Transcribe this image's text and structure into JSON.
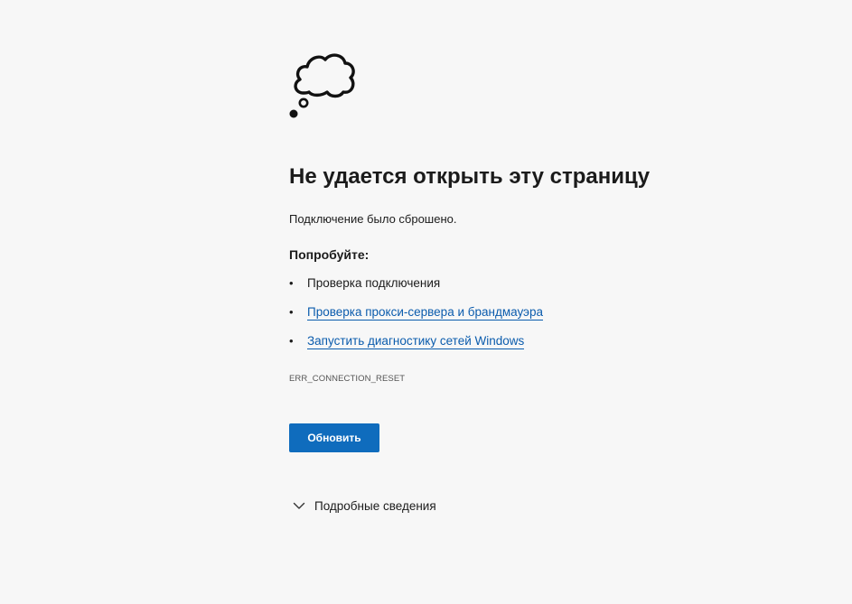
{
  "error": {
    "title": "Не удается открыть эту страницу",
    "message": "Подключение было сброшено.",
    "try_heading": "Попробуйте:",
    "suggestions": [
      {
        "label": "Проверка подключения",
        "link": false
      },
      {
        "label": "Проверка прокси-сервера и брандмауэра",
        "link": true
      },
      {
        "label": "Запустить диагностику сетей Windows",
        "link": true
      }
    ],
    "code": "ERR_CONNECTION_RESET",
    "reload_label": "Обновить",
    "details_label": "Подробные сведения",
    "icon": "thought-cloud-icon"
  },
  "colors": {
    "background": "#f7f7f7",
    "link": "#0b5cad",
    "button": "#0f6cbd"
  }
}
